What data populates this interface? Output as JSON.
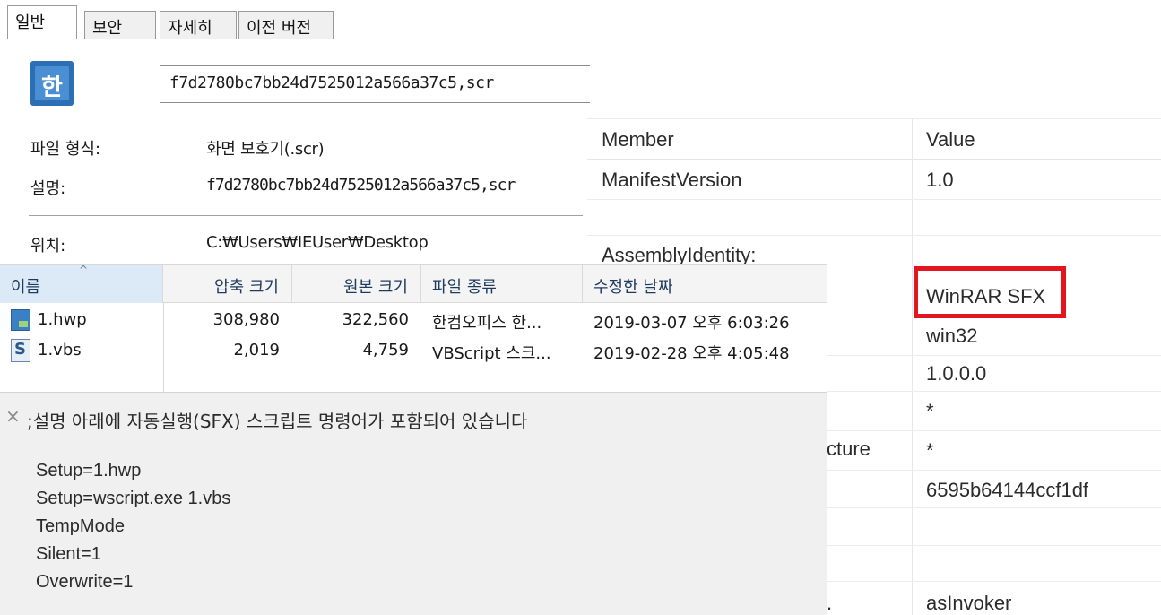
{
  "properties": {
    "tabs": [
      "일반",
      "보안",
      "자세히",
      "이전 버전"
    ],
    "active_tab": 0,
    "icon_glyph": "한",
    "file_name": "f7d2780bc7bb24d7525012a566a37c5,scr",
    "rows": [
      {
        "label": "파일 형식:",
        "value": "화면 보호기(.scr)"
      },
      {
        "label": "설명:",
        "value": "f7d2780bc7bb24d7525012a566a37c5,scr"
      },
      {
        "label": "위치:",
        "value": "C:₩Users₩IEUser₩Desktop"
      }
    ]
  },
  "archive": {
    "columns": [
      "이름",
      "압축 크기",
      "원본 크기",
      "파일 종류",
      "수정한 날짜"
    ],
    "sort_arrow": "^",
    "rows": [
      {
        "icon": "hwp-file-icon",
        "name": "1.hwp",
        "packed": "308,980",
        "size": "322,560",
        "type": "한컴오피스 한...",
        "modified": "2019-03-07 오후 6:03:26"
      },
      {
        "icon": "vbs-file-icon",
        "name": "1.vbs",
        "packed": "2,019",
        "size": "4,759",
        "type": "VBScript 스크...",
        "modified": "2019-02-28 오후 4:05:48"
      }
    ]
  },
  "comment": {
    "close_glyph": "×",
    "title": ";설명 아래에 자동실행(SFX) 스크립트 명령어가 포함되어 있습니다",
    "lines": [
      "Setup=1.hwp",
      "Setup=wscript.exe 1.vbs",
      "TempMode",
      "Silent=1",
      "Overwrite=1"
    ]
  },
  "manifest": {
    "header": {
      "member": "Member",
      "value": "Value"
    },
    "members": {
      "manifest_version": "ManifestVersion",
      "assembly_identity": "AssemblyIdentity:",
      "partial_architecture": "cture"
    },
    "values": {
      "manifest_version": "1.0",
      "name": "WinRAR SFX",
      "type": "win32",
      "version": "1.0.0.0",
      "language": "*",
      "architecture": "*",
      "token": "6595b64144ccf1df",
      "level": "asInvoker"
    },
    "highlight_color": "#e3151f"
  }
}
